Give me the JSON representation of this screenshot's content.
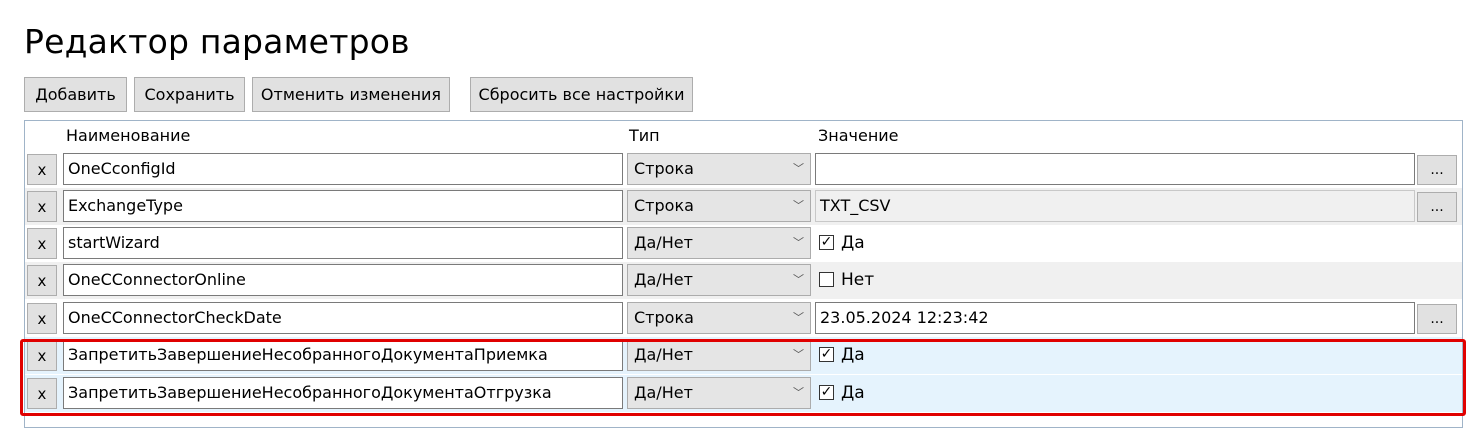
{
  "title": "Редактор параметров",
  "toolbar": {
    "add_label": "Добавить",
    "save_label": "Сохранить",
    "cancel_label": "Отменить изменения",
    "reset_label": "Сбросить все настройки"
  },
  "columns": {
    "name": "Наименование",
    "type": "Тип",
    "value": "Значение"
  },
  "delete_label": "x",
  "browse_label": "...",
  "rows": [
    {
      "name": "OneCconfigId",
      "type": "Строка",
      "value": ""
    },
    {
      "name": "ExchangeType",
      "type": "Строка",
      "value": "TXT_CSV"
    },
    {
      "name": "startWizard",
      "type": "Да/Нет",
      "checked": true,
      "value": "Да"
    },
    {
      "name": "OneCConnectorOnline",
      "type": "Да/Нет",
      "checked": false,
      "value": "Нет"
    },
    {
      "name": "OneCConnectorCheckDate",
      "type": "Строка",
      "value": "23.05.2024 12:23:42"
    },
    {
      "name": "ЗапретитьЗавершениеНесобранногоДокументаПриемка",
      "type": "Да/Нет",
      "checked": true,
      "value": "Да"
    },
    {
      "name": "ЗапретитьЗавершениеНесобранногоДокументаОтгрузка",
      "type": "Да/Нет",
      "checked": true,
      "value": "Да"
    }
  ],
  "colors": {
    "highlight": "#e00000",
    "selected_row": "#e5f3fd",
    "grid_border": "#a0b4c8"
  }
}
